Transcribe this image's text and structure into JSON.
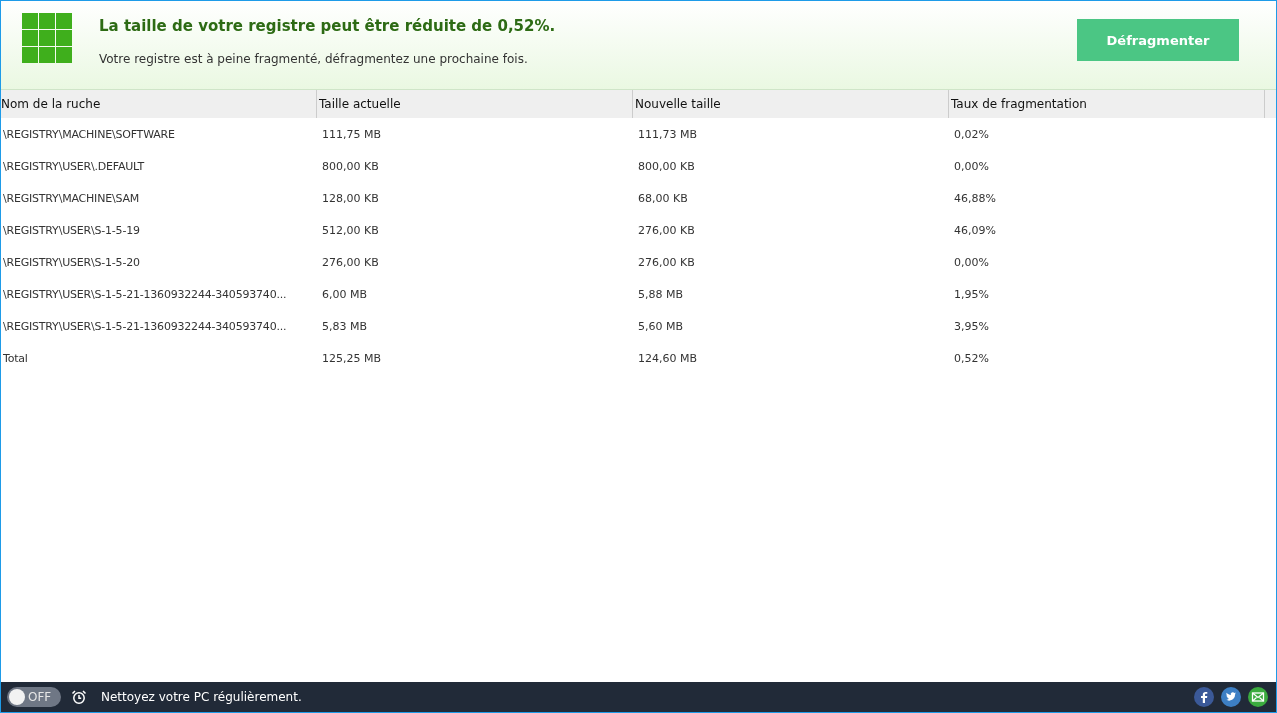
{
  "header": {
    "title": "La taille de votre registre peut être réduite de 0,52%.",
    "subtitle": "Votre registre est à peine fragmenté, défragmentez une prochaine fois.",
    "button": "Défragmenter"
  },
  "table": {
    "columns": [
      "Nom de la ruche",
      "Taille actuelle",
      "Nouvelle taille",
      "Taux de fragmentation"
    ],
    "rows": [
      [
        "\\REGISTRY\\MACHINE\\SOFTWARE",
        "111,75 MB",
        "111,73 MB",
        "0,02%"
      ],
      [
        "\\REGISTRY\\USER\\.DEFAULT",
        "800,00 KB",
        "800,00 KB",
        "0,00%"
      ],
      [
        "\\REGISTRY\\MACHINE\\SAM",
        "128,00 KB",
        "68,00 KB",
        "46,88%"
      ],
      [
        "\\REGISTRY\\USER\\S-1-5-19",
        "512,00 KB",
        "276,00 KB",
        "46,09%"
      ],
      [
        "\\REGISTRY\\USER\\S-1-5-20",
        "276,00 KB",
        "276,00 KB",
        "0,00%"
      ],
      [
        "\\REGISTRY\\USER\\S-1-5-21-1360932244-340593740...",
        "6,00 MB",
        "5,88 MB",
        "1,95%"
      ],
      [
        "\\REGISTRY\\USER\\S-1-5-21-1360932244-340593740...",
        "5,83 MB",
        "5,60 MB",
        "3,95%"
      ],
      [
        "Total",
        "125,25 MB",
        "124,60 MB",
        "0,52%"
      ]
    ]
  },
  "footer": {
    "schedule_toggle": {
      "on": false,
      "label": "OFF"
    },
    "message": "Nettoyez votre PC régulièrement."
  }
}
